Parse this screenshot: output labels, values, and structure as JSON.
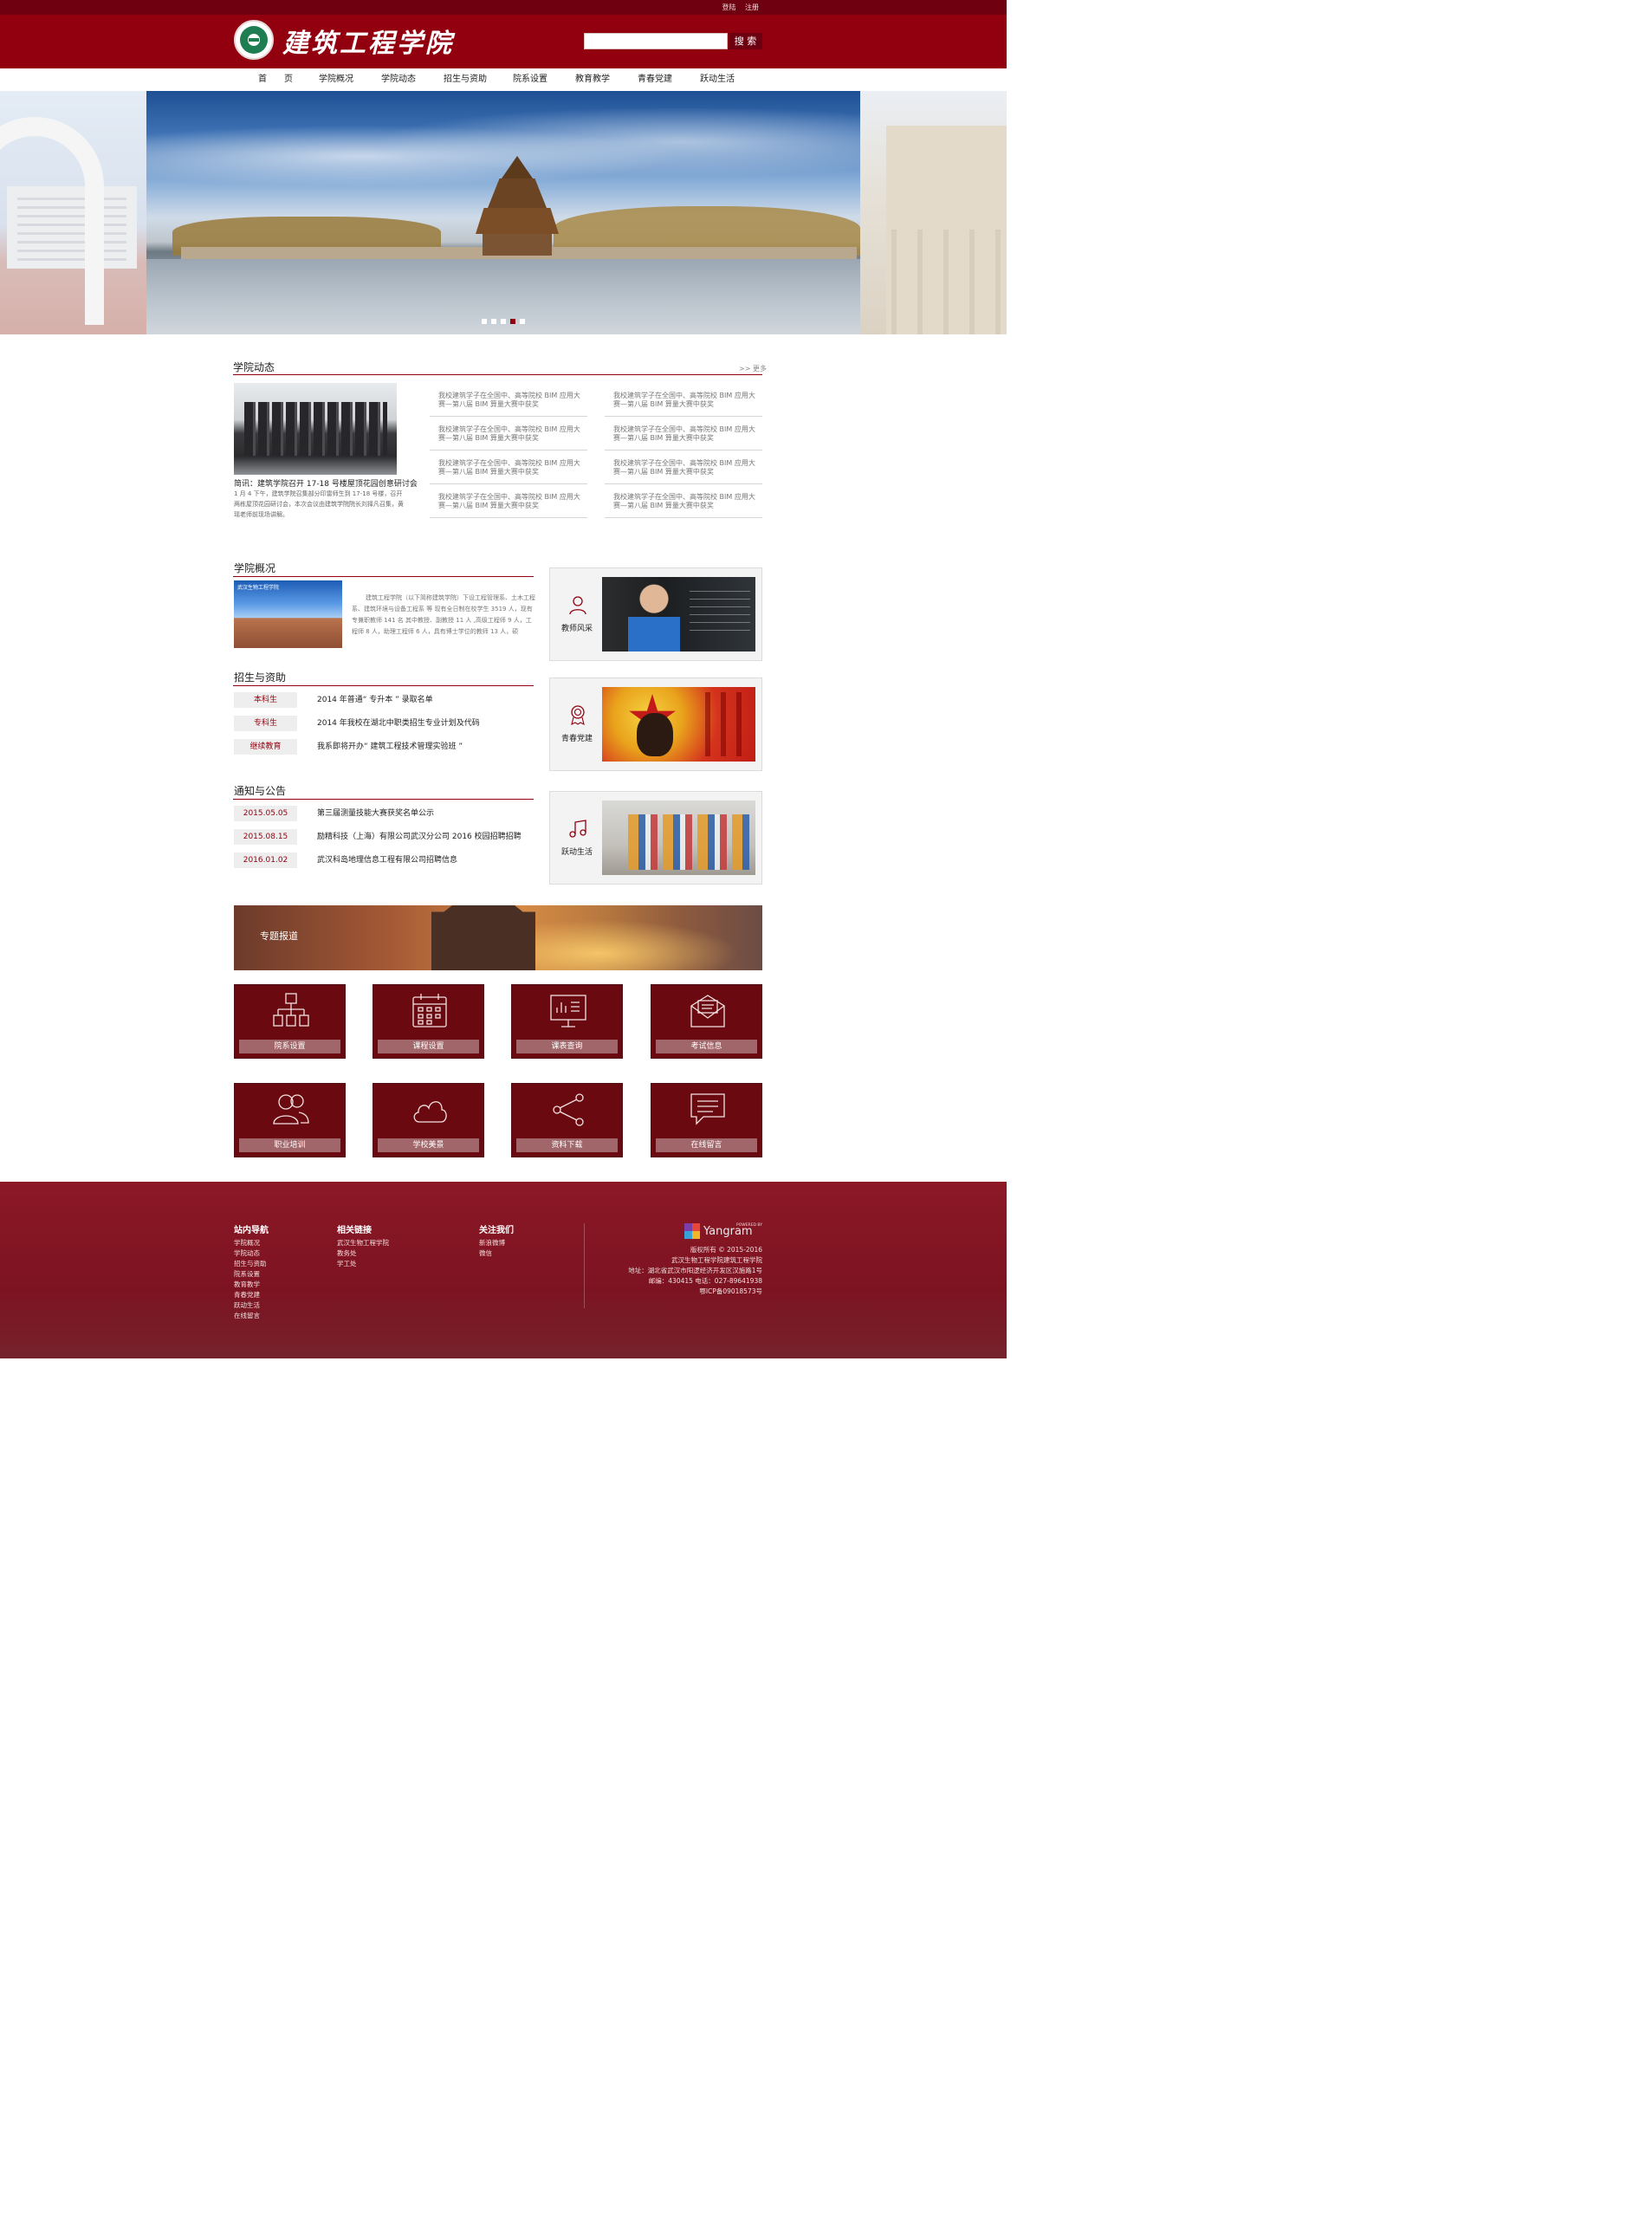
{
  "topbar": {
    "login": "登陆",
    "register": "注册"
  },
  "header": {
    "brand": "建筑工程学院",
    "search_placeholder": "",
    "search_button": "搜 索"
  },
  "nav": [
    "首　　页",
    "学院概况",
    "学院动态",
    "招生与资助",
    "院系设置",
    "教育教学",
    "青春党建",
    "跃动生活"
  ],
  "banner": {
    "dots": 5,
    "active_dot": 4
  },
  "news": {
    "title": "学院动态",
    "more": ">> 更多",
    "headline": "简讯：建筑学院召开 17-18 号楼屋顶花园创意研讨会",
    "desc": "1 月 4 下午，建筑学院召集部分印雷师生到 17-18 号楼，召开两栋屋顶花园研讨会，本次会议由建筑学院院长刘择凡召集，黄瑶老师前现场讲解。",
    "items": [
      "我校建筑学子在全国中、高等院校 BIM 应用大赛—第八届 BIM 算量大赛中获奖",
      "我校建筑学子在全国中、高等院校 BIM 应用大赛—第八届 BIM 算量大赛中获奖",
      "我校建筑学子在全国中、高等院校 BIM 应用大赛—第八届 BIM 算量大赛中获奖",
      "我校建筑学子在全国中、高等院校 BIM 应用大赛—第八届 BIM 算量大赛中获奖",
      "我校建筑学子在全国中、高等院校 BIM 应用大赛—第八届 BIM 算量大赛中获奖",
      "我校建筑学子在全国中、高等院校 BIM 应用大赛—第八届 BIM 算量大赛中获奖",
      "我校建筑学子在全国中、高等院校 BIM 应用大赛—第八届 BIM 算量大赛中获奖",
      "我校建筑学子在全国中、高等院校 BIM 应用大赛—第八届 BIM 算量大赛中获奖"
    ]
  },
  "overview": {
    "title": "学院概况",
    "img_caption": "武汉生物工程学院",
    "text": "建筑工程学院（以下简称建筑学院）下设工程管理系、土木工程系、建筑环境与设备工程系 等 现有全日制在校学生 3519 人，现有专兼职教师 141 名 其中教授、副教授 11 人 ,高级工程师 9 人，工程师 8 人，助理工程师 6 人，具有博士学位的教师 13 人，硕"
  },
  "admissions": {
    "title": "招生与资助",
    "rows": [
      {
        "label": "本科生",
        "text": "2014 年普通“ 专升本 ” 录取名单"
      },
      {
        "label": "专科生",
        "text": "2014 年我校在湖北中职类招生专业计划及代码"
      },
      {
        "label": "继续教育",
        "text": "我系即将开办“ 建筑工程技术管理实验班 ”"
      }
    ]
  },
  "notices": {
    "title": "通知与公告",
    "rows": [
      {
        "date": "2015.05.05",
        "text": "第三届测量技能大赛获奖名单公示"
      },
      {
        "date": "2015.08.15",
        "text": "励精科技（上海）有限公司武汉分公司 2016 校园招聘招聘"
      },
      {
        "date": "2016.01.02",
        "text": "武汉科岛地理信息工程有限公司招聘信息"
      }
    ]
  },
  "cards": [
    {
      "label": "教师风采",
      "icon": "person-icon"
    },
    {
      "label": "青春党建",
      "icon": "badge-icon"
    },
    {
      "label": "跃动生活",
      "icon": "music-note-icon"
    }
  ],
  "special": {
    "label": "专题报道"
  },
  "tiles": [
    {
      "label": "院系设置",
      "icon": "org-chart-icon"
    },
    {
      "label": "课程设置",
      "icon": "calendar-icon"
    },
    {
      "label": "课表查询",
      "icon": "monitor-chart-icon"
    },
    {
      "label": "考试信息",
      "icon": "envelope-icon"
    },
    {
      "label": "职业培训",
      "icon": "users-icon"
    },
    {
      "label": "学校美景",
      "icon": "cloud-icon"
    },
    {
      "label": "资料下载",
      "icon": "share-icon"
    },
    {
      "label": "在线留言",
      "icon": "message-icon"
    }
  ],
  "footer": {
    "nav_title": "站内导航",
    "nav_items": [
      "学院概况",
      "学院动态",
      "招生与资助",
      "院系设置",
      "教育教学",
      "青春党建",
      "跃动生活",
      "在线留言"
    ],
    "links_title": "相关链接",
    "links_items": [
      "武汉生物工程学院",
      "教务处",
      "学工处"
    ],
    "follow_title": "关注我们",
    "follow_items": [
      "新浪微博",
      "微信"
    ],
    "powered": "POWERED BY",
    "powered_brand": "Yangram",
    "info": [
      "版权所有 © 2015-2016",
      "武汉生物工程学院建筑工程学院",
      "地址：湖北省武汉市阳逻经济开发区汉施路1号",
      "邮编：430415 电话：027-89641938",
      "鄂ICP备09018573号"
    ]
  },
  "colors": {
    "primary": "#92000f",
    "dark": "#6e0010",
    "tile": "#6a0a10"
  }
}
